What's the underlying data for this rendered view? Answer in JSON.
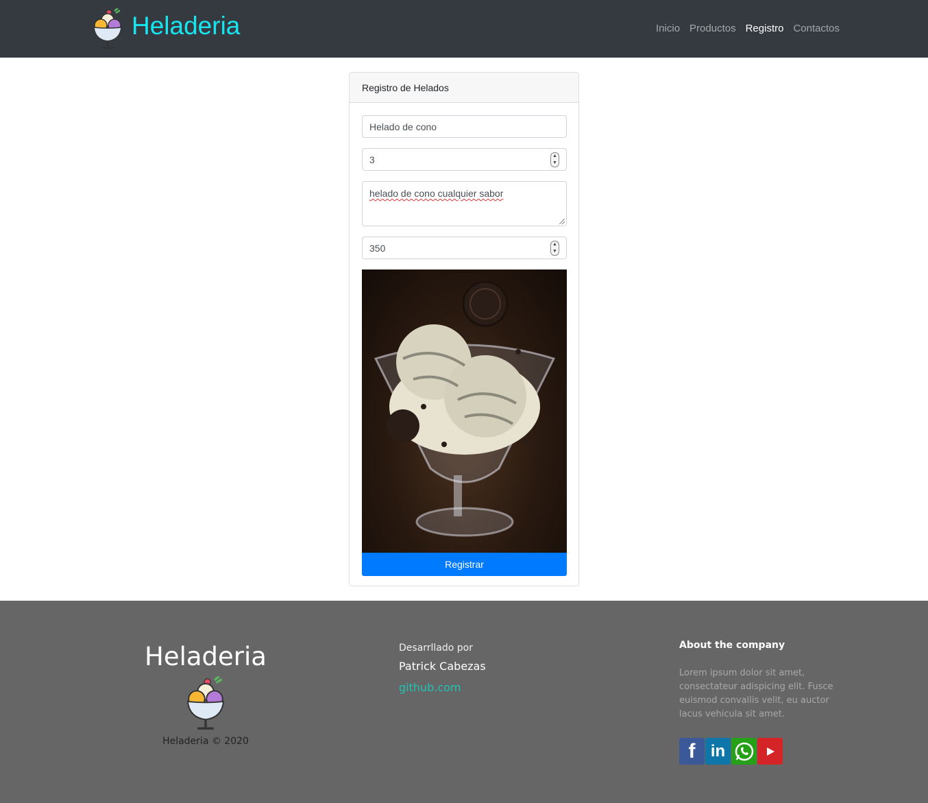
{
  "navbar": {
    "brand": "Heladeria",
    "links": [
      {
        "label": "Inicio",
        "active": false
      },
      {
        "label": "Productos",
        "active": false
      },
      {
        "label": "Registro",
        "active": true
      },
      {
        "label": "Contactos",
        "active": false
      }
    ]
  },
  "form": {
    "header": "Registro de Helados",
    "name_value": "Helado de cono",
    "quantity_value": "3",
    "description_value": "helado de cono cualquier sabor",
    "price_value": "350",
    "submit_label": "Registrar"
  },
  "footer": {
    "title": "Heladeria",
    "copyright": "Heladeria © 2020",
    "dev_label": "Desarrllado por",
    "dev_name": "Patrick Cabezas",
    "link_text": "github.com",
    "about_title": "About the company",
    "about_text": "Lorem ipsum dolor sit amet, consectateur adispicing elit. Fusce euismod convallis velit, eu auctor lacus vehicula sit amet.",
    "socials": [
      "facebook-icon",
      "linkedin-icon",
      "whatsapp-icon",
      "youtube-icon"
    ]
  },
  "colors": {
    "navbar_bg": "#343a40",
    "brand": "#17e5f0",
    "primary": "#007bff",
    "footer_bg": "#666666",
    "link": "#20c3b3"
  }
}
